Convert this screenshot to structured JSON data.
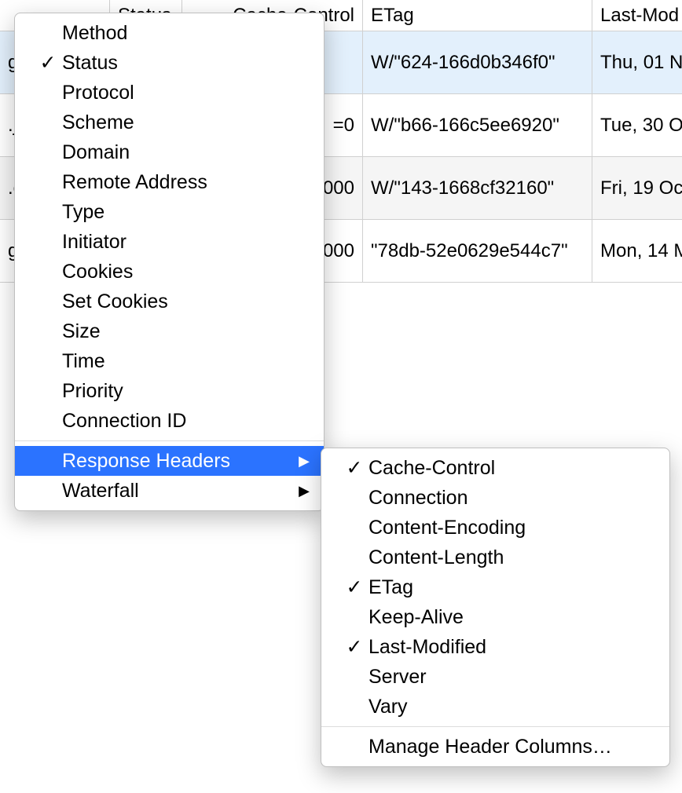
{
  "table": {
    "headers": {
      "name": "",
      "status": "Status",
      "cache_control": "Cache-Control",
      "etag": "ETag",
      "last_modified": "Last-Mod"
    },
    "rows": [
      {
        "name": "g",
        "status": "",
        "cache_control": "",
        "etag": "W/\"624-166d0b346f0\"",
        "last_modified": "Thu, 01 N"
      },
      {
        "name": ".js",
        "status": "",
        "cache_control": "=0",
        "etag": "W/\"b66-166c5ee6920\"",
        "last_modified": "Tue, 30 O"
      },
      {
        "name": ".c",
        "status": "",
        "cache_control": "000",
        "etag": "W/\"143-1668cf32160\"",
        "last_modified": "Fri, 19 Oc"
      },
      {
        "name": "g\nrg",
        "status": "",
        "cache_control": "000",
        "etag": "\"78db-52e0629e544c7\"",
        "last_modified": "Mon, 14 M"
      }
    ]
  },
  "menu_main": [
    {
      "label": "Method",
      "checked": false,
      "submenu": false
    },
    {
      "label": "Status",
      "checked": true,
      "submenu": false
    },
    {
      "label": "Protocol",
      "checked": false,
      "submenu": false
    },
    {
      "label": "Scheme",
      "checked": false,
      "submenu": false
    },
    {
      "label": "Domain",
      "checked": false,
      "submenu": false
    },
    {
      "label": "Remote Address",
      "checked": false,
      "submenu": false
    },
    {
      "label": "Type",
      "checked": false,
      "submenu": false
    },
    {
      "label": "Initiator",
      "checked": false,
      "submenu": false
    },
    {
      "label": "Cookies",
      "checked": false,
      "submenu": false
    },
    {
      "label": "Set Cookies",
      "checked": false,
      "submenu": false
    },
    {
      "label": "Size",
      "checked": false,
      "submenu": false
    },
    {
      "label": "Time",
      "checked": false,
      "submenu": false
    },
    {
      "label": "Priority",
      "checked": false,
      "submenu": false
    },
    {
      "label": "Connection ID",
      "checked": false,
      "submenu": false
    }
  ],
  "menu_main_after_sep": [
    {
      "label": "Response Headers",
      "checked": false,
      "submenu": true,
      "highlight": true
    },
    {
      "label": "Waterfall",
      "checked": false,
      "submenu": true
    }
  ],
  "menu_sub": [
    {
      "label": "Cache-Control",
      "checked": true
    },
    {
      "label": "Connection",
      "checked": false
    },
    {
      "label": "Content-Encoding",
      "checked": false
    },
    {
      "label": "Content-Length",
      "checked": false
    },
    {
      "label": "ETag",
      "checked": true
    },
    {
      "label": "Keep-Alive",
      "checked": false
    },
    {
      "label": "Last-Modified",
      "checked": true
    },
    {
      "label": "Server",
      "checked": false
    },
    {
      "label": "Vary",
      "checked": false
    }
  ],
  "menu_sub_footer": "Manage Header Columns…",
  "glyphs": {
    "check": "✓",
    "arrow": "▶"
  }
}
